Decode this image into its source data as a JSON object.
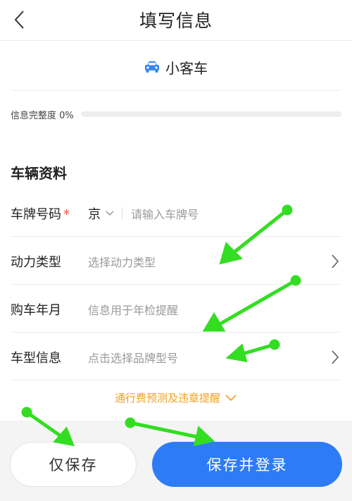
{
  "header": {
    "title": "填写信息",
    "back_icon": "chevron-left-icon"
  },
  "vehicle": {
    "type_label": "小客车",
    "icon": "car-icon",
    "icon_color": "#3a86f0"
  },
  "completeness": {
    "label": "信息完整度 0%",
    "percent": 0
  },
  "section": {
    "title": "车辆资料"
  },
  "fields": [
    {
      "label": "车牌号码",
      "required_mark": "*",
      "province": "京",
      "placeholder": "请输入车牌号"
    },
    {
      "label": "动力类型",
      "placeholder": "选择动力类型"
    },
    {
      "label": "购车年月",
      "placeholder": "信息用于年检提醒"
    },
    {
      "label": "车型信息",
      "placeholder": "点击选择品牌型号"
    }
  ],
  "toggle": {
    "label": "通行费预测及违章提醒"
  },
  "buttons": {
    "save_only": "仅保存",
    "save_and_login": "保存并登录"
  },
  "colors": {
    "accent": "#2d7cf6",
    "required": "#f04b3a",
    "toggle_text": "#f0a020",
    "annotation": "#33dd22"
  }
}
